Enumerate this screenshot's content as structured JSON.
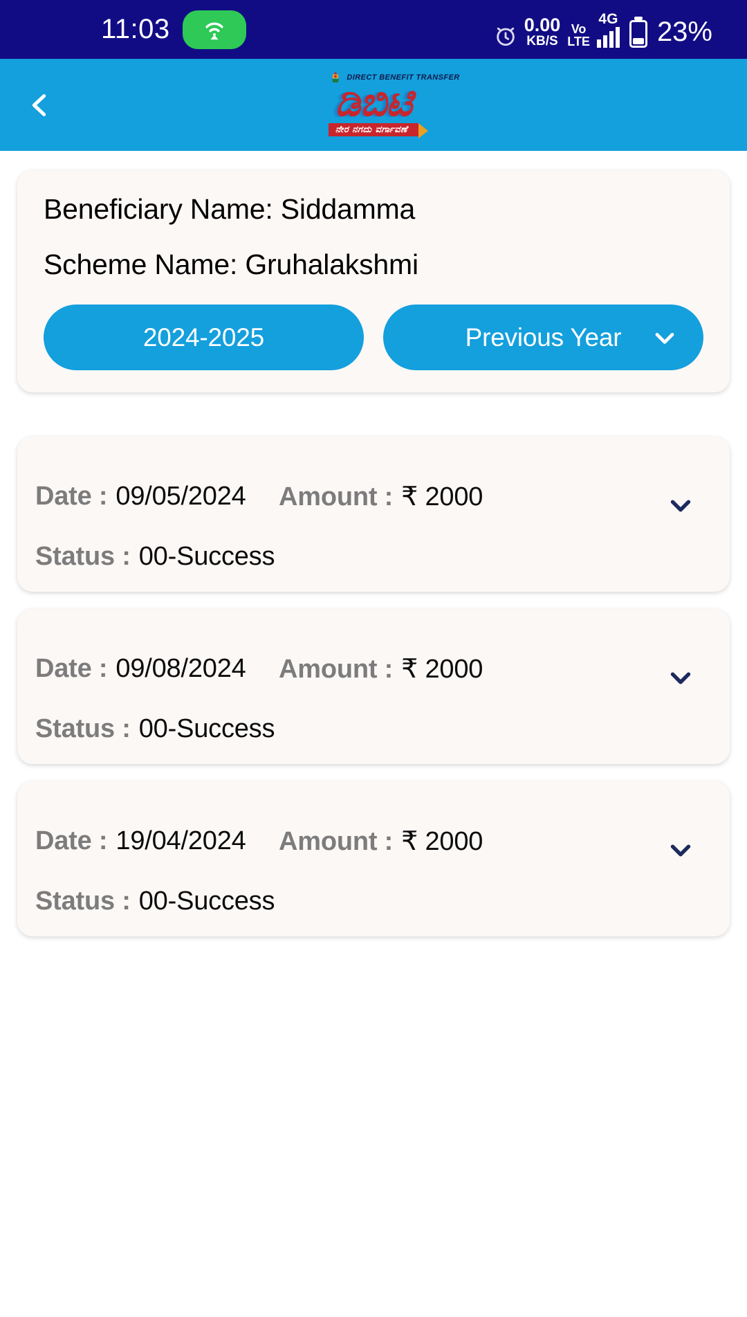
{
  "status_bar": {
    "time": "11:03",
    "hotspot_icon": "wifi-hotspot-icon",
    "alarm_icon": "alarm-clock-icon",
    "net_speed_value": "0.00",
    "net_speed_unit": "KB/S",
    "volte_line1": "Vo",
    "volte_line2": "LTE",
    "network_type": "4G",
    "network_plus": "+",
    "battery_percent": "23%",
    "background_color": "#120c84"
  },
  "header": {
    "back_icon": "back-chevron-icon",
    "emblem_icon": "karnataka-emblem-icon",
    "dbt_label": "DIRECT BENEFIT TRANSFER",
    "logo_text": "ಡಿಬಿಟಿ",
    "logo_tagline": "ನೇರ ನಗದು ವರ್ಗಾವಣೆ",
    "background_color": "#149fdd"
  },
  "info_card": {
    "beneficiary_line": "Beneficiary Name: Siddamma",
    "scheme_line": "Scheme Name: Gruhalakshmi",
    "year_button": "2024-2025",
    "previous_year_button": "Previous Year",
    "dropdown_icon": "chevron-down-icon"
  },
  "transactions": {
    "label_date": "Date :",
    "label_amount": "Amount :",
    "label_status": "Status :",
    "expand_icon": "chevron-down-icon",
    "items": [
      {
        "date": "09/05/2024",
        "amount": "₹ 2000",
        "status": "00-Success"
      },
      {
        "date": "09/08/2024",
        "amount": "₹ 2000",
        "status": "00-Success"
      },
      {
        "date": "19/04/2024",
        "amount": "₹ 2000",
        "status": "00-Success"
      }
    ]
  },
  "colors": {
    "accent": "#149fdd",
    "status_bar": "#120c84",
    "card": "#fcf8f6",
    "chevron": "#1d2a5c",
    "label_grey": "#7c7c7c"
  }
}
